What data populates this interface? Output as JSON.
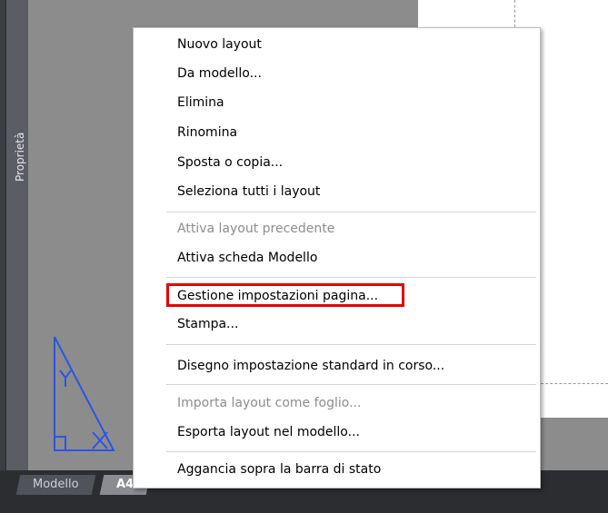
{
  "palette": {
    "label": "Proprietà"
  },
  "tabs": [
    {
      "label": "Modello"
    },
    {
      "label": "A4"
    }
  ],
  "add_tab_icon": "plus-icon",
  "highlight_color": "#e60000",
  "context_menu": {
    "items": [
      {
        "label": "Nuovo layout",
        "enabled": true
      },
      {
        "label": "Da modello...",
        "enabled": true
      },
      {
        "label": "Elimina",
        "enabled": true
      },
      {
        "label": "Rinomina",
        "enabled": true
      },
      {
        "label": "Sposta o copia...",
        "enabled": true
      },
      {
        "label": "Seleziona tutti i layout",
        "enabled": true
      },
      {
        "label": "Attiva layout precedente",
        "enabled": false
      },
      {
        "label": "Attiva scheda Modello",
        "enabled": true
      },
      {
        "label": "Gestione impostazioni pagina...",
        "enabled": true,
        "highlighted": true
      },
      {
        "label": "Stampa...",
        "enabled": true
      },
      {
        "label": "Disegno impostazione standard in corso...",
        "enabled": true
      },
      {
        "label": "Importa layout come foglio...",
        "enabled": false
      },
      {
        "label": "Esporta layout nel modello...",
        "enabled": true
      },
      {
        "label": "Aggancia sopra la barra di stato",
        "enabled": true
      }
    ]
  }
}
